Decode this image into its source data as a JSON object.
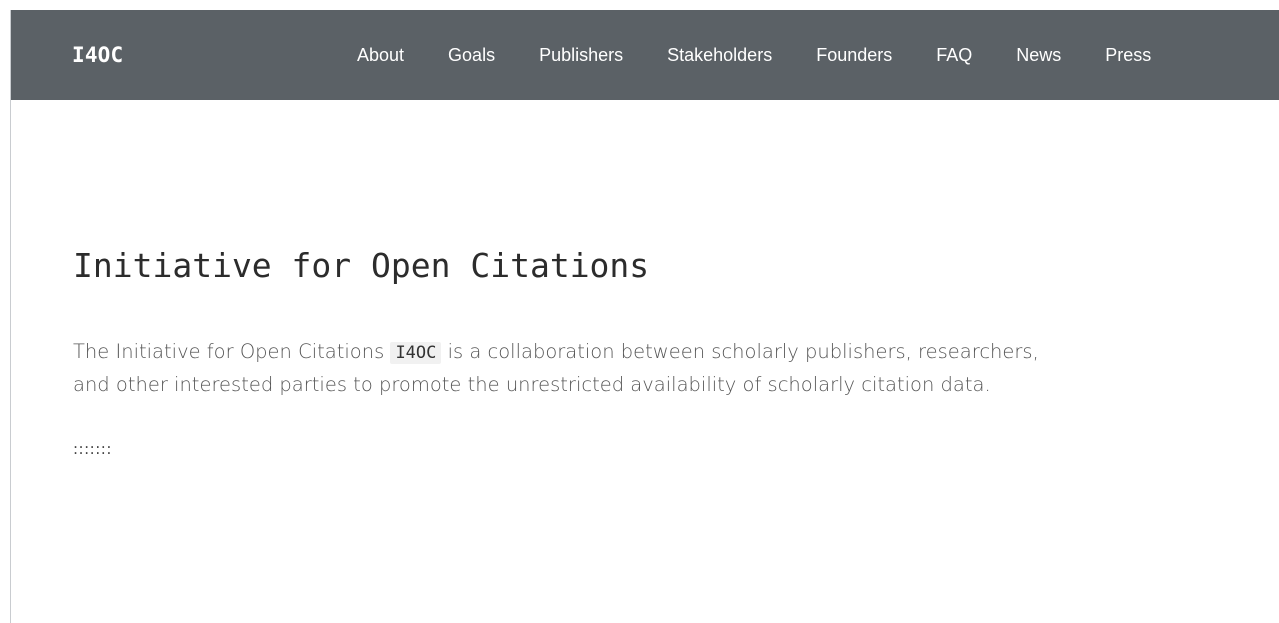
{
  "navbar": {
    "brand": "I4OC",
    "links": [
      {
        "label": "About"
      },
      {
        "label": "Goals"
      },
      {
        "label": "Publishers"
      },
      {
        "label": "Stakeholders"
      },
      {
        "label": "Founders"
      },
      {
        "label": "FAQ"
      },
      {
        "label": "News"
      },
      {
        "label": "Press"
      }
    ]
  },
  "main": {
    "title": "Initiative for Open Citations",
    "intro_before": "The Initiative for Open Citations ",
    "intro_code": "I4OC",
    "intro_after": " is a collaboration between scholarly publishers, researchers, and other interested parties to promote the unrestricted availability of scholarly citation data.",
    "separator": ":::::::"
  },
  "colors": {
    "navbar_bg": "#5b6166",
    "nav_text": "#ffffff",
    "title_text": "#2c2c2c",
    "body_text": "#555555",
    "code_bg": "#f1f1f1"
  }
}
